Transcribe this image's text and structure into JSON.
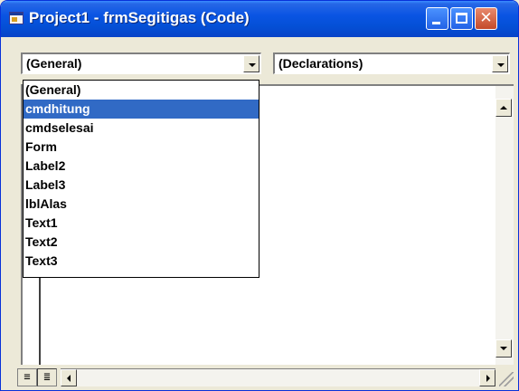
{
  "window": {
    "title": "Project1 - frmSegitigas (Code)",
    "close_glyph": "✕"
  },
  "object_combo": {
    "selected": "(General)"
  },
  "procedure_combo": {
    "selected": "(Declarations)"
  },
  "dropdown": {
    "items": [
      "(General)",
      "cmdhitung",
      "cmdselesai",
      "Form",
      "Label2",
      "Label3",
      "lblAlas",
      "Text1",
      "Text2",
      "Text3"
    ],
    "selected_index": 1
  },
  "view_buttons": {
    "procedure_view_glyph": "≡",
    "full_module_view_glyph": "≣"
  },
  "colors": {
    "titlebar": "#0a54e3",
    "selection": "#316ac5"
  }
}
